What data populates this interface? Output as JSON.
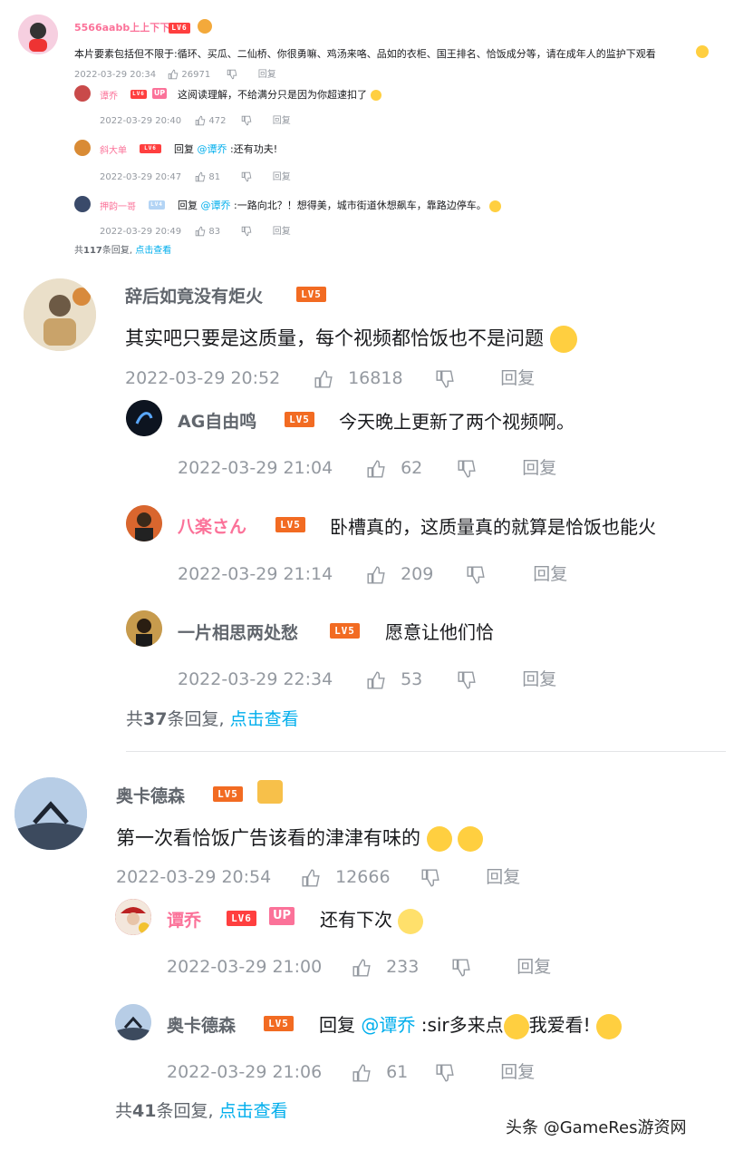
{
  "top_comment": {
    "user": "5566aabb上上下下",
    "level": "LV6",
    "text": "本片要素包括但不限于:循环、买瓜、二仙桥、你很勇嘛、鸡汤来咯、品如的衣柜、国王排名、恰饭成分等，请在成年人的监护下观看",
    "time": "2022-03-29 20:34",
    "likes": "26971",
    "reply_label": "回复",
    "replies": [
      {
        "user": "谭乔",
        "level": "LV6",
        "badge": "UP",
        "text": "这阅读理解，不给满分只是因为你超速扣了",
        "time": "2022-03-29 20:40",
        "likes": "472",
        "reply_label": "回复"
      },
      {
        "user": "斜大单",
        "level": "LV6",
        "prefix": "回复",
        "mention": "@谭乔",
        "text": ":还有功夫!",
        "time": "2022-03-29 20:47",
        "likes": "81",
        "reply_label": "回复"
      },
      {
        "user": "押韵一哥",
        "level": "LV4",
        "prefix": "回复",
        "mention": "@谭乔",
        "text": ":一路向北？！想得美，城市街道休想飙车，靠路边停车。",
        "time": "2022-03-29 20:49",
        "likes": "83",
        "reply_label": "回复"
      }
    ],
    "summary_prefix": "共",
    "summary_count": "117",
    "summary_suffix": "条回复,",
    "summary_link": "点击查看"
  },
  "comment2": {
    "user": "辞后如竟没有炬火",
    "level": "LV5",
    "text": "其实吧只要是这质量，每个视频都恰饭也不是问题",
    "time": "2022-03-29 20:52",
    "likes": "16818",
    "reply_label": "回复",
    "replies": [
      {
        "user": "AG自由鸣",
        "level": "LV5",
        "text": "今天晚上更新了两个视频啊。",
        "time": "2022-03-29 21:04",
        "likes": "62",
        "reply_label": "回复"
      },
      {
        "user": "八楽さん",
        "level": "LV5",
        "text": "卧槽真的，这质量真的就算是恰饭也能火",
        "time": "2022-03-29 21:14",
        "likes": "209",
        "reply_label": "回复"
      },
      {
        "user": "一片相思两处愁",
        "level": "LV5",
        "text": "愿意让他们恰",
        "time": "2022-03-29 22:34",
        "likes": "53",
        "reply_label": "回复"
      }
    ],
    "summary_prefix": "共",
    "summary_count": "37",
    "summary_suffix": "条回复,",
    "summary_link": "点击查看"
  },
  "comment3": {
    "user": "奥卡德森",
    "level": "LV5",
    "text": "第一次看恰饭广告该看的津津有味的",
    "time": "2022-03-29 20:54",
    "likes": "12666",
    "reply_label": "回复",
    "replies": [
      {
        "user": "谭乔",
        "level": "LV6",
        "badge": "UP",
        "text": "还有下次",
        "time": "2022-03-29 21:00",
        "likes": "233",
        "reply_label": "回复"
      },
      {
        "user": "奥卡德森",
        "level": "LV5",
        "prefix": "回复",
        "mention": "@谭乔",
        "text": ":sir多来点",
        "text2": "我爱看!",
        "time": "2022-03-29 21:06",
        "likes": "61",
        "reply_label": "回复"
      }
    ],
    "summary_prefix": "共",
    "summary_count": "41",
    "summary_suffix": "条回复,",
    "summary_link": "点击查看"
  },
  "watermark": "头条 @GameRes游资网",
  "colors": {
    "level": "#f26b22",
    "level6": "#ff3f3f",
    "up_badge": "#fb7299",
    "link": "#00aeec",
    "pink_name": "#fb7299",
    "meta": "#9499a0"
  }
}
